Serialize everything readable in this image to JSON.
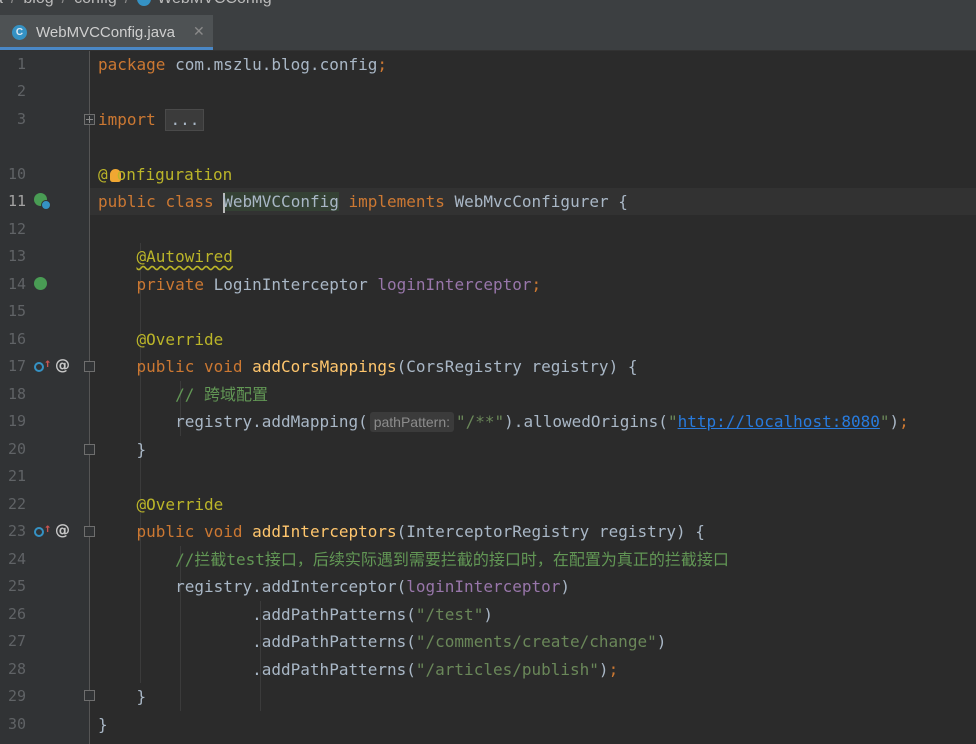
{
  "breadcrumb": {
    "parts": [
      "a",
      "blog",
      "config"
    ],
    "file": "WebMVCConfig"
  },
  "tab": {
    "label": "WebMVCConfig.java",
    "icon_letter": "C",
    "close": "✕"
  },
  "editor": {
    "current_line": 11,
    "line_numbers": [
      1,
      2,
      3,
      10,
      11,
      12,
      13,
      14,
      15,
      16,
      17,
      18,
      19,
      20,
      21,
      22,
      23,
      24,
      25,
      26,
      27,
      28,
      29,
      30
    ],
    "code": {
      "l1": {
        "kw": "package",
        "text": " com.mszlu.blog.config",
        "semi": ";"
      },
      "l3": {
        "kw": "import",
        "folded": "..."
      },
      "l10": {
        "at": "@",
        "rest": "onfiguration"
      },
      "l11": {
        "kw1": "public",
        "kw2": "class",
        "cls_cursor": "W",
        "cls_rest": "ebMVCConfig",
        "kw3": "implements",
        "iface": "WebMvcConfigurer",
        "brace": "{"
      },
      "l13": {
        "ann": "@Autowired"
      },
      "l14": {
        "kw": "private",
        "type": "LoginInterceptor",
        "field": "loginInterceptor",
        "semi": ";"
      },
      "l16": {
        "ann": "@Override"
      },
      "l17": {
        "kw1": "public",
        "kw2": "void",
        "fn": "addCorsMappings",
        "params": "(CorsRegistry registry) {"
      },
      "l18": {
        "comment": "// 跨域配置"
      },
      "l19": {
        "recv": "registry.addMapping(",
        "hint": "pathPattern:",
        "str1": "\"/**\"",
        "mid": ").allowedOrigins(",
        "q1": "\"",
        "url": "http://localhost:8080",
        "q2": "\"",
        "end": ")",
        "semi": ";"
      },
      "l20": {
        "brace": "}"
      },
      "l22": {
        "ann": "@Override"
      },
      "l23": {
        "kw1": "public",
        "kw2": "void",
        "fn": "addInterceptors",
        "params": "(InterceptorRegistry registry) {"
      },
      "l24": {
        "comment": "//拦截test接口，后续实际遇到需要拦截的接口时，在配置为真正的拦截接口"
      },
      "l25": {
        "recv": "registry.addInterceptor(",
        "field": "loginInterceptor",
        "end": ")"
      },
      "l26": {
        "call": ".addPathPatterns(",
        "str": "\"/test\"",
        "end": ")"
      },
      "l27": {
        "call": ".addPathPatterns(",
        "str": "\"/comments/create/change\"",
        "end": ")"
      },
      "l28": {
        "call": ".addPathPatterns(",
        "str": "\"/articles/publish\"",
        "end": ")",
        "semi": ";"
      },
      "l29": {
        "brace": "}"
      },
      "l30": {
        "brace": "}"
      }
    }
  },
  "gutter_icons": {
    "l11": "spring-bean-icon",
    "l14": "spring-autowired-icon",
    "l17": "override-method-icon",
    "l23": "override-method-icon"
  },
  "colors": {
    "background": "#2b2b2b",
    "gutter": "#313335",
    "keyword": "#cc7832",
    "annotation": "#bbb529",
    "field": "#9876aa",
    "string": "#6a8759",
    "comment": "#629755",
    "method": "#ffc66d"
  }
}
